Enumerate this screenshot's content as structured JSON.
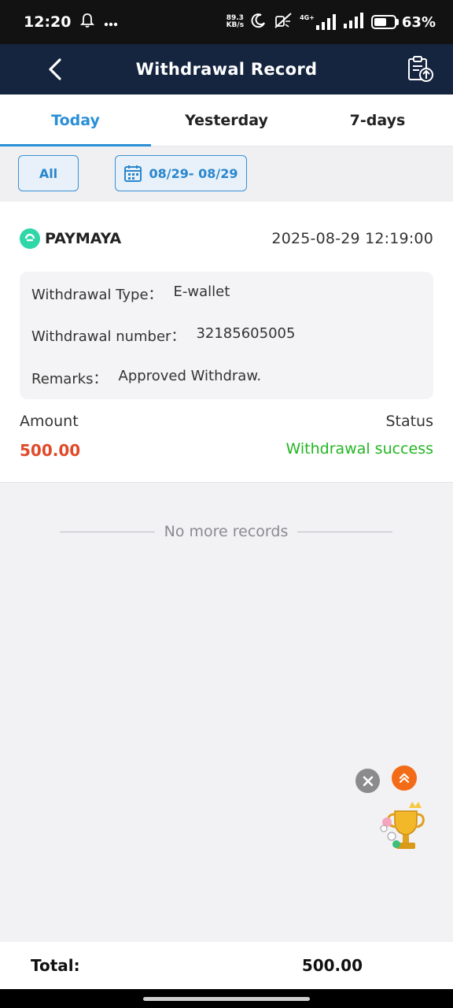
{
  "status_bar": {
    "time": "12:20",
    "network_speed_value": "89.3",
    "network_speed_unit": "KB/s",
    "network_type": "4G+",
    "battery_percent": "63%",
    "battery_level": 0.63
  },
  "header": {
    "title": "Withdrawal Record"
  },
  "tabs": [
    {
      "label": "Today",
      "active": true
    },
    {
      "label": "Yesterday",
      "active": false
    },
    {
      "label": "7-days",
      "active": false
    }
  ],
  "filters": {
    "all_label": "All",
    "date_range": "08/29- 08/29"
  },
  "record": {
    "method": "PAYMAYA",
    "datetime": "2025-08-29 12:19:00",
    "type_label": "Withdrawal Type：",
    "type_value": "E-wallet",
    "number_label": "Withdrawal number：",
    "number_value": "32185605005",
    "remarks_label": "Remarks：",
    "remarks_value": "Approved Withdraw.",
    "amount_label": "Amount",
    "amount_value": "500.00",
    "status_label": "Status",
    "status_value": "Withdrawal success"
  },
  "list_end_text": "No more records",
  "footer": {
    "total_label": "Total:",
    "total_value": "500.00"
  },
  "colors": {
    "header_bg": "#15243f",
    "accent": "#2a8fd6",
    "amount": "#e04a2a",
    "success": "#22b522",
    "paymaya": "#2fd6a8",
    "scroll_top": "#f36b17"
  }
}
